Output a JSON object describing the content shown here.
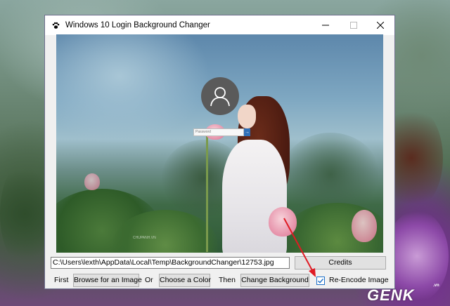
{
  "window": {
    "title": "Windows 10 Login Background Changer",
    "controls": {
      "minimize": "—",
      "maximize": "☐",
      "close": "✕"
    }
  },
  "preview": {
    "password_placeholder": "Password",
    "password_go": "→",
    "watermark": "CHUPANH.VN"
  },
  "path_field": {
    "value": "C:\\Users\\lexth\\AppData\\Local\\Temp\\BackgroundChanger\\12753.jpg"
  },
  "buttons": {
    "credits": "Credits",
    "browse": "Browse for an Image",
    "choose_color": "Choose a Color",
    "change_background": "Change Background"
  },
  "labels": {
    "first": "First",
    "or": "Or",
    "then": "Then"
  },
  "reencode": {
    "label": "Re-Encode Image",
    "checked": true
  },
  "site_watermark": {
    "text": "GENK",
    "suffix": ".vn"
  },
  "colors": {
    "accent": "#1c6fc8",
    "annotation_arrow": "#e01b24"
  }
}
